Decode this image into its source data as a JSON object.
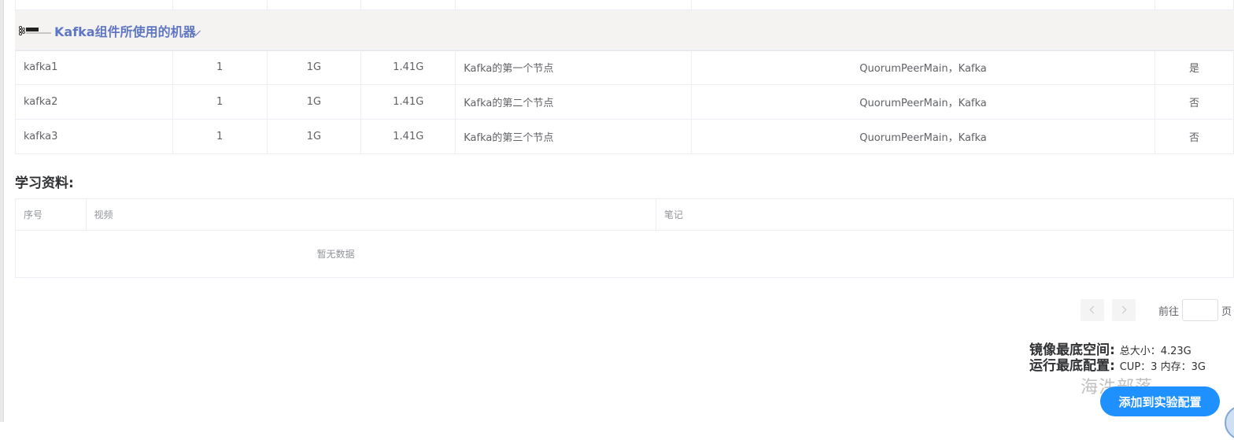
{
  "group": {
    "title": "Kafka组件所使用的机器"
  },
  "machines": [
    {
      "name": "kafka1",
      "cpu": "1",
      "mem": "1G",
      "disk": "1.41G",
      "desc": "Kafka的第一个节点",
      "services": "QuorumPeerMain，Kafka",
      "master": "是"
    },
    {
      "name": "kafka2",
      "cpu": "1",
      "mem": "1G",
      "disk": "1.41G",
      "desc": "Kafka的第二个节点",
      "services": "QuorumPeerMain，Kafka",
      "master": "否"
    },
    {
      "name": "kafka3",
      "cpu": "1",
      "mem": "1G",
      "disk": "1.41G",
      "desc": "Kafka的第三个节点",
      "services": "QuorumPeerMain，Kafka",
      "master": "否"
    }
  ],
  "study": {
    "title": "学习资料:",
    "columns": [
      "序号",
      "视频",
      "笔记"
    ],
    "empty_text": "暂无数据"
  },
  "pagination": {
    "goto_label": "前往",
    "goto_value": "",
    "suffix": "页"
  },
  "requirements": {
    "image_label": "镜像最底空间:",
    "image_value": "总大小：4.23G",
    "run_label": "运行最底配置:",
    "run_value": "CUP：3 内存：3G"
  },
  "watermark": "海汼部落",
  "add_button": "添加到实验配置",
  "colors": {
    "accent": "#1e90ff",
    "group_title": "#5f77c3",
    "group_bg": "#f5f3f2"
  }
}
